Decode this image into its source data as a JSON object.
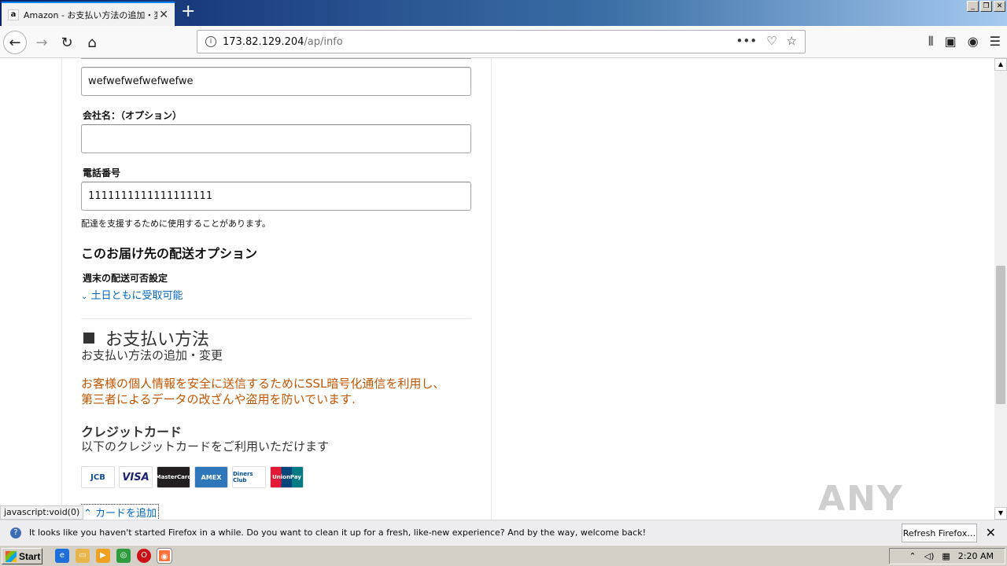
{
  "browser": {
    "tab_title": "Amazon - お支払い方法の追加・変更",
    "tab_favicon": "a",
    "tab_close": "✕",
    "new_tab": "+",
    "url_host": "173.82.129.204",
    "url_path": "/ap/info",
    "url_actions": [
      "•••",
      "♡",
      "☆"
    ],
    "window_buttons": [
      "_",
      "❐",
      "✕"
    ]
  },
  "form": {
    "name_value": "wefwefwefwefwefwe",
    "company_label": "会社名：（オプション）",
    "company_value": "",
    "phone_label": "電話番号",
    "phone_value": "1111111111111111111",
    "phone_note": "配達を支援するために使用することがあります。",
    "delivery_heading": "このお届け先の配送オプション",
    "weekend_label": "週末の配送可否設定",
    "weekend_link": "土日ともに受取可能"
  },
  "payment": {
    "title": "お支払い方法",
    "subtitle": "お支払い方法の追加・変更",
    "ssl_notice_line1": "お客様の個人情報を安全に送信するためにSSL暗号化通信を利用し、",
    "ssl_notice_line2": "第三者によるデータの改ざんや盗用を防いでいます.",
    "credit_heading": "クレジットカード",
    "credit_sub": "以下のクレジットカードをご利用いただけます",
    "cards": [
      "JCB",
      "VISA",
      "MasterCard",
      "AMEX",
      "Diners Club",
      "UnionPay"
    ],
    "add_card": "カードを追加"
  },
  "status_link": "javascript:void(0)",
  "watermark": "ANY RUN",
  "notification": {
    "message": "It looks like you haven't started Firefox in a while. Do you want to clean it up for a fresh, like-new experience? And by the way, welcome back!",
    "button": "Refresh Firefox…"
  },
  "taskbar": {
    "start": "Start",
    "time": "2:20 AM"
  }
}
